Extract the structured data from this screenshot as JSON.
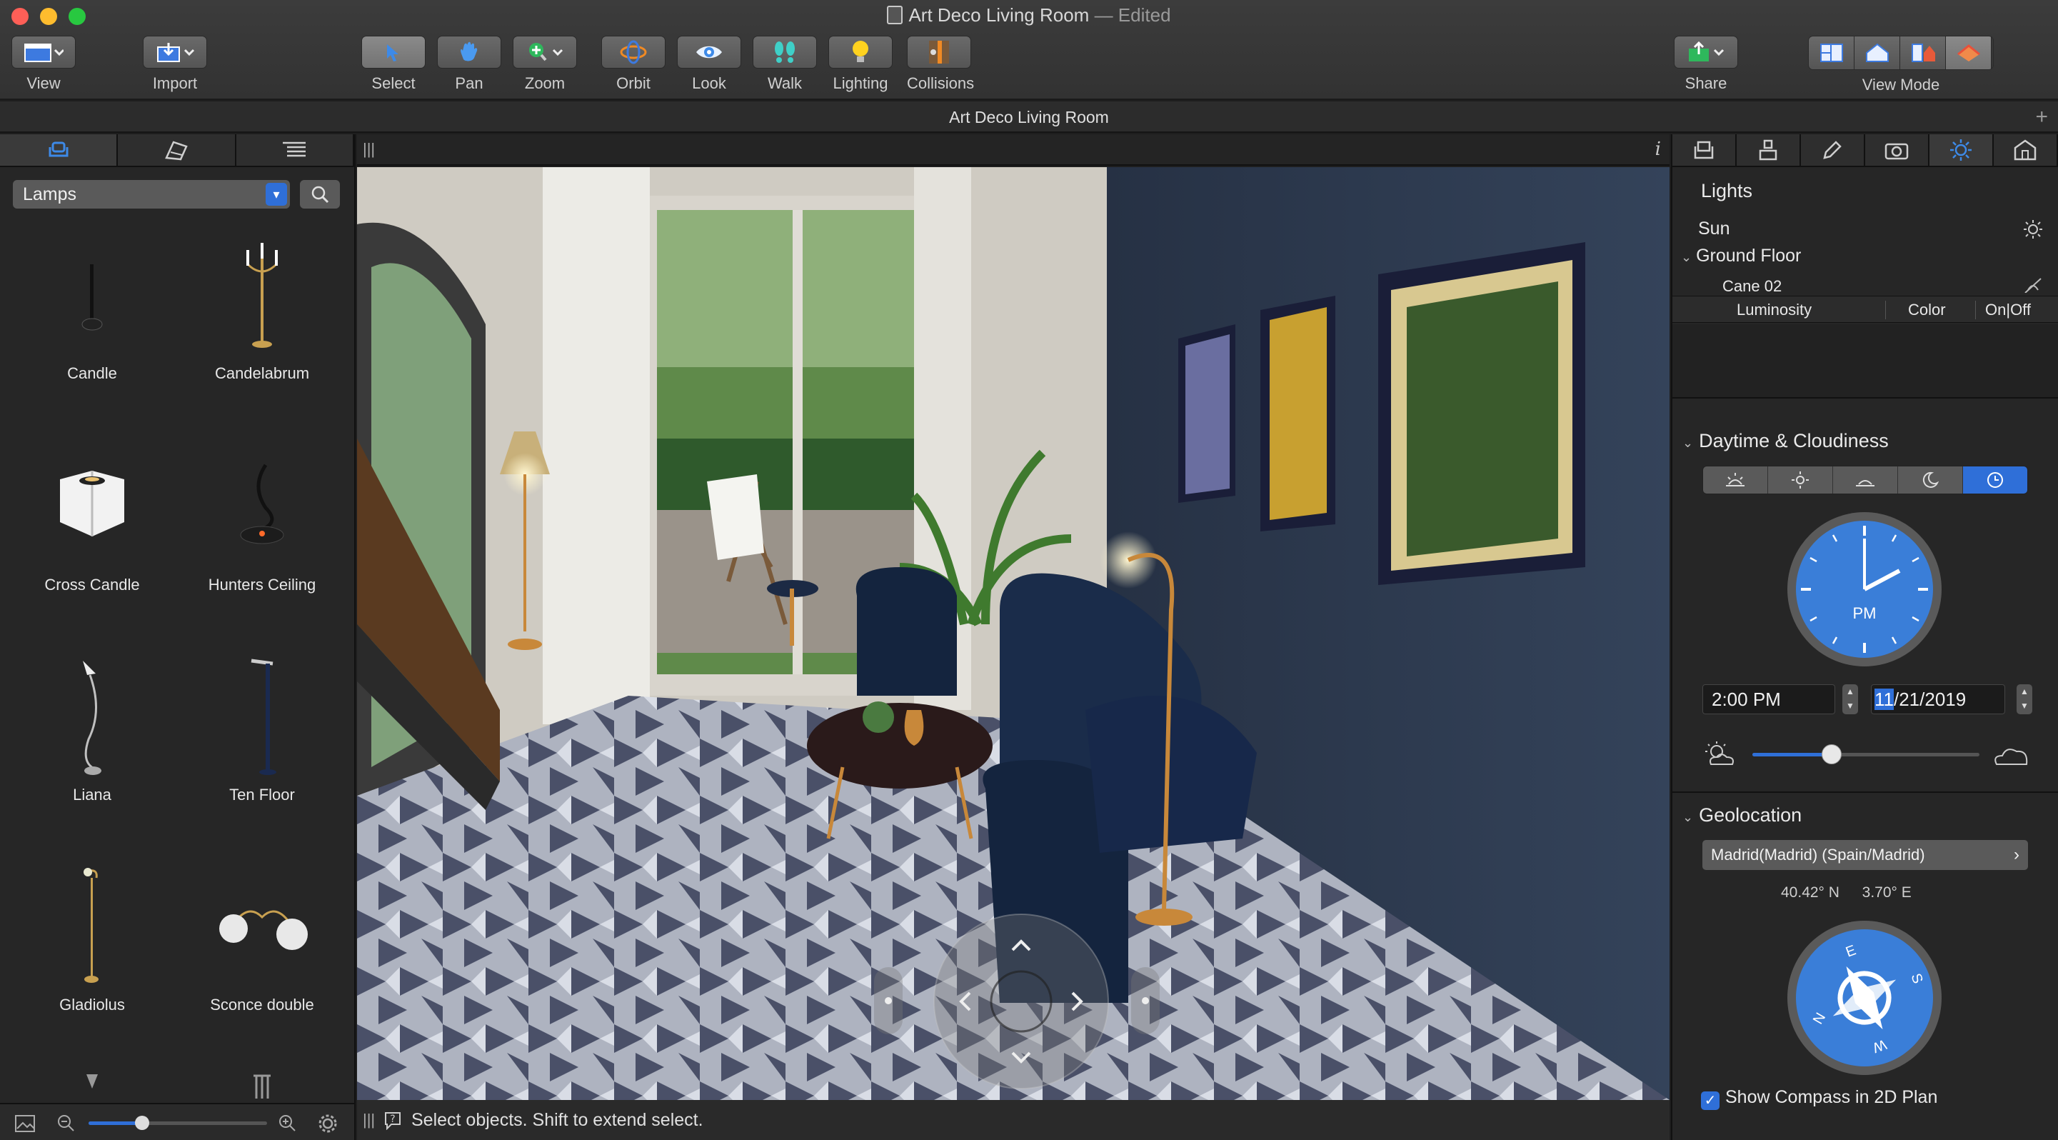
{
  "window": {
    "title": "Art Deco Living Room",
    "edited_suffix": "— Edited",
    "tab_title": "Art Deco Living Room"
  },
  "toolbar": {
    "view": "View",
    "import": "Import",
    "select": "Select",
    "pan": "Pan",
    "zoom": "Zoom",
    "orbit": "Orbit",
    "look": "Look",
    "walk": "Walk",
    "lighting": "Lighting",
    "collisions": "Collisions",
    "share": "Share",
    "view_mode": "View Mode"
  },
  "library": {
    "category": "Lamps",
    "items": [
      {
        "label": "Candle"
      },
      {
        "label": "Candelabrum"
      },
      {
        "label": "Cross Candle"
      },
      {
        "label": "Hunters Ceiling"
      },
      {
        "label": "Liana"
      },
      {
        "label": "Ten Floor"
      },
      {
        "label": "Gladiolus"
      },
      {
        "label": "Sconce double"
      }
    ],
    "thumb_zoom": 0.3
  },
  "status": {
    "message": "Select objects. Shift to extend select."
  },
  "inspector": {
    "lights_title": "Lights",
    "sun": "Sun",
    "ground_floor": "Ground Floor",
    "cane": "Cane 02",
    "columns": {
      "luminosity": "Luminosity",
      "color": "Color",
      "onoff": "On|Off"
    },
    "daytime_title": "Daytime & Cloudiness",
    "clock_ampm": "PM",
    "time": "2:00 PM",
    "date": "11/21/2019",
    "date_highlight": "11",
    "cloudiness": 0.35,
    "geolocation_title": "Geolocation",
    "location": "Madrid(Madrid) (Spain/Madrid)",
    "lat": "40.42° N",
    "lon": "3.70° E",
    "compass_letters": [
      "N",
      "E",
      "S",
      "W"
    ],
    "show_compass": "Show Compass in 2D Plan",
    "show_compass_checked": true
  },
  "colors": {
    "accent": "#2f6fd8",
    "close": "#fe5f57",
    "minimize": "#febc2e",
    "zoom": "#28c840"
  }
}
